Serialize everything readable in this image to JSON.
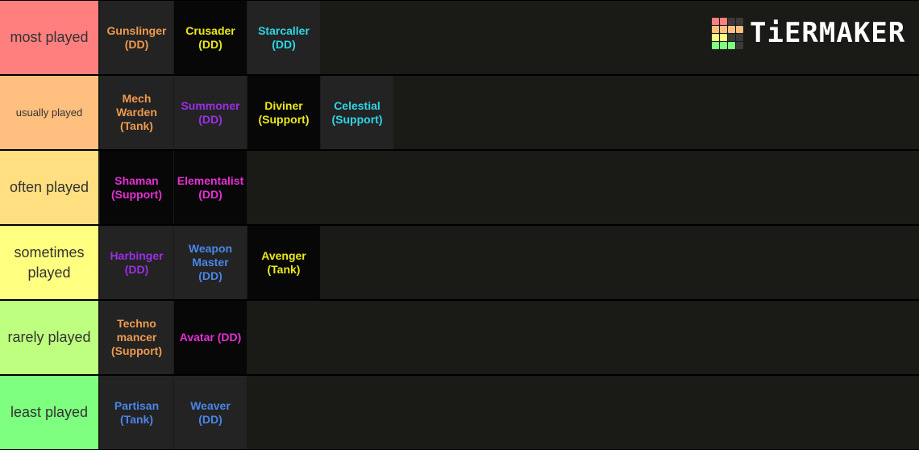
{
  "logo": {
    "text": "TiERMAKER",
    "grid_colors": [
      "#ff7f7f",
      "#ff7f7f",
      "#3a3a3a",
      "#3a3a3a",
      "#ffbf7f",
      "#ffbf7f",
      "#ffbf7f",
      "#ffbf7f",
      "#ffff7f",
      "#ffff7f",
      "#3a3a3a",
      "#3a3a3a",
      "#7fff7f",
      "#7fff7f",
      "#7fff7f",
      "#3a3a3a"
    ]
  },
  "tiers": [
    {
      "label": "most played",
      "color": "#ff7f7f",
      "small": false,
      "items": [
        {
          "text": "Gunslinger\n(DD)",
          "color": "#ef9a4e",
          "bg": "dark"
        },
        {
          "text": "Crusader\n(DD)",
          "color": "#eaea1c",
          "bg": "black"
        },
        {
          "text": "Starcaller\n(DD)",
          "color": "#2fd6e6",
          "bg": "dark"
        }
      ]
    },
    {
      "label": "usually played",
      "color": "#ffbf7f",
      "small": true,
      "items": [
        {
          "text": "Mech\nWarden\n(Tank)",
          "color": "#ef9a4e",
          "bg": "dark"
        },
        {
          "text": "Summoner\n(DD)",
          "color": "#9b2fe8",
          "bg": "dark"
        },
        {
          "text": "Diviner\n(Support)",
          "color": "#eaea1c",
          "bg": "black"
        },
        {
          "text": "Celestial\n(Support)",
          "color": "#2fd6e6",
          "bg": "dark"
        }
      ]
    },
    {
      "label": "often played",
      "color": "#ffdf7f",
      "small": false,
      "items": [
        {
          "text": "Shaman\n(Support)",
          "color": "#e82fd6",
          "bg": "black"
        },
        {
          "text": "Elementalist\n(DD)",
          "color": "#e82fd6",
          "bg": "black"
        }
      ]
    },
    {
      "label": "sometimes played",
      "color": "#ffff7f",
      "small": false,
      "items": [
        {
          "text": "Harbinger\n(DD)",
          "color": "#9b2fe8",
          "bg": "dark"
        },
        {
          "text": "Weapon\nMaster\n(DD)",
          "color": "#4a86e8",
          "bg": "dark"
        },
        {
          "text": "Avenger\n(Tank)",
          "color": "#eaea1c",
          "bg": "black"
        }
      ]
    },
    {
      "label": "rarely played",
      "color": "#bfff7f",
      "small": false,
      "items": [
        {
          "text": "Techno\nmancer\n(Support)",
          "color": "#ef9a4e",
          "bg": "dark"
        },
        {
          "text": "Avatar (DD)",
          "color": "#e82fd6",
          "bg": "black"
        }
      ]
    },
    {
      "label": "least played",
      "color": "#7fff7f",
      "small": false,
      "items": [
        {
          "text": "Partisan\n(Tank)",
          "color": "#4a86e8",
          "bg": "dark"
        },
        {
          "text": "Weaver\n(DD)",
          "color": "#4a86e8",
          "bg": "dark"
        }
      ]
    }
  ]
}
